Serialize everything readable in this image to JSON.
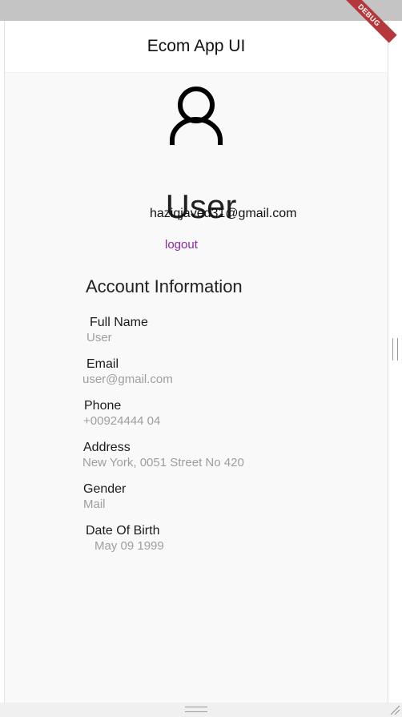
{
  "app_bar": {
    "title": "Ecom App UI",
    "debug_label": "DEBUG"
  },
  "profile": {
    "avatar_icon": "person-outline-icon",
    "name": "User",
    "email": "haziqjaved31@gmail.com",
    "logout_label": "logout"
  },
  "account": {
    "heading": "Account Information",
    "fields": [
      {
        "label": "Full Name",
        "value": "User"
      },
      {
        "label": "Email",
        "value": "user@gmail.com"
      },
      {
        "label": "Phone",
        "value": "+00924444 04"
      },
      {
        "label": "Address",
        "value": "New York, 0051 Street No 420"
      },
      {
        "label": "Gender",
        "value": "Mail"
      },
      {
        "label": "Date Of Birth",
        "value": "May 09 1999"
      }
    ]
  },
  "colors": {
    "link": "#8e24aa",
    "debug_ribbon": "#b4383c",
    "value_text": "#9e9e9e"
  }
}
